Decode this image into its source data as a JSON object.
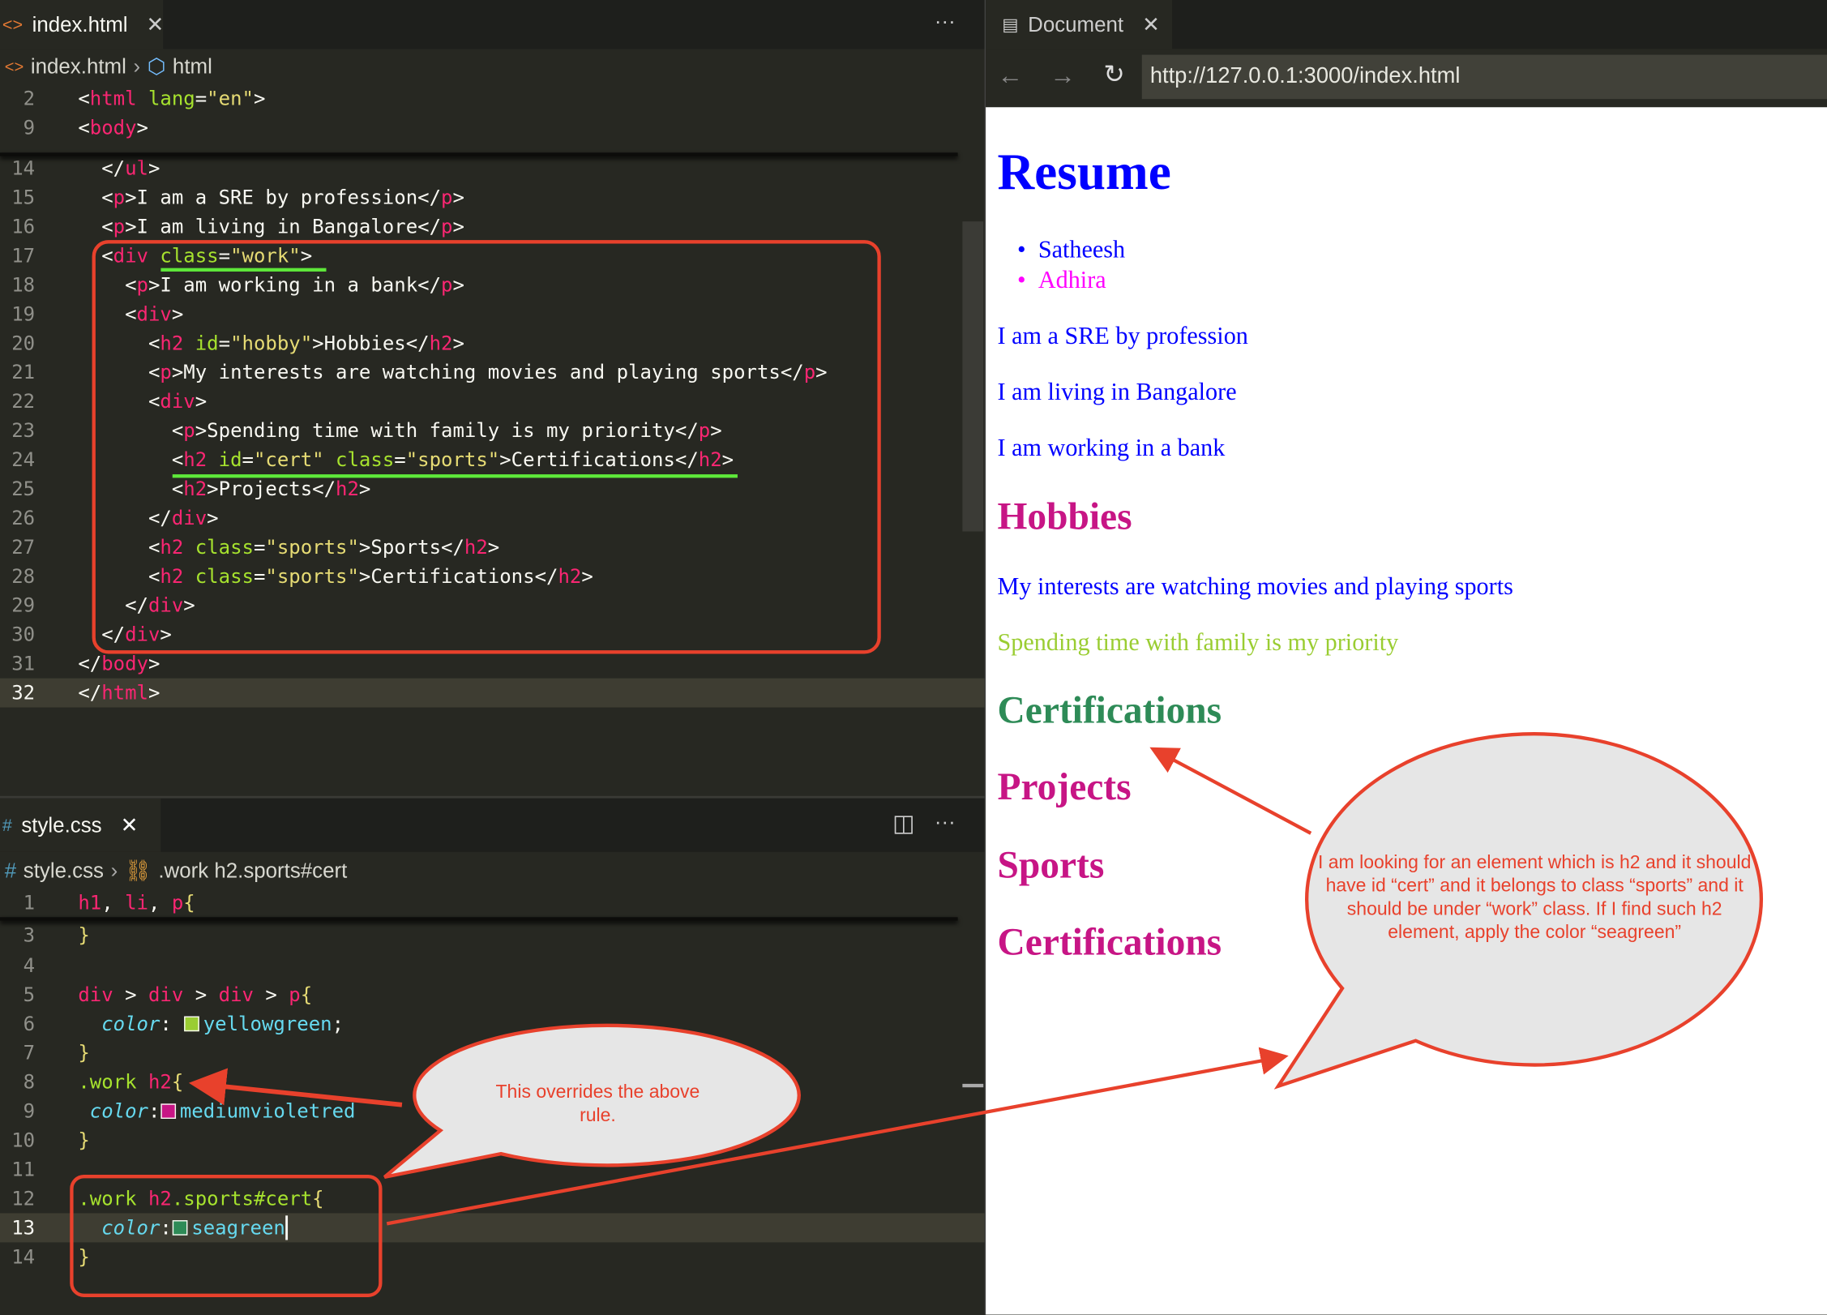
{
  "html_editor": {
    "tab_label": "index.html",
    "more_label": "···",
    "breadcrumb": [
      "index.html",
      "html"
    ],
    "current_line": 32,
    "lines": [
      {
        "num": 2,
        "tokens": [
          [
            "p",
            "<"
          ],
          [
            "g",
            "html"
          ],
          [
            "x",
            " "
          ],
          [
            "a",
            "lang"
          ],
          [
            "p",
            "="
          ],
          [
            "s",
            "\"en\""
          ],
          [
            "p",
            ">"
          ]
        ]
      },
      {
        "num": 9,
        "tokens": [
          [
            "p",
            "<"
          ],
          [
            "g",
            "body"
          ],
          [
            "p",
            ">"
          ]
        ]
      },
      {
        "num": 14,
        "tokens": [
          [
            "x",
            "  "
          ],
          [
            "p",
            "</"
          ],
          [
            "g",
            "ul"
          ],
          [
            "p",
            ">"
          ]
        ]
      },
      {
        "num": 15,
        "tokens": [
          [
            "x",
            "  "
          ],
          [
            "p",
            "<"
          ],
          [
            "g",
            "p"
          ],
          [
            "p",
            ">"
          ],
          [
            "x",
            "I am a SRE by profession"
          ],
          [
            "p",
            "</"
          ],
          [
            "g",
            "p"
          ],
          [
            "p",
            ">"
          ]
        ]
      },
      {
        "num": 16,
        "tokens": [
          [
            "x",
            "  "
          ],
          [
            "p",
            "<"
          ],
          [
            "g",
            "p"
          ],
          [
            "p",
            ">"
          ],
          [
            "x",
            "I am living in Bangalore"
          ],
          [
            "p",
            "</"
          ],
          [
            "g",
            "p"
          ],
          [
            "p",
            ">"
          ]
        ]
      },
      {
        "num": 17,
        "tokens": [
          [
            "x",
            "  "
          ],
          [
            "p",
            "<"
          ],
          [
            "g",
            "div"
          ],
          [
            "x",
            " "
          ],
          [
            "a",
            "class"
          ],
          [
            "p",
            "="
          ],
          [
            "s",
            "\"work\""
          ],
          [
            "p",
            ">"
          ]
        ]
      },
      {
        "num": 18,
        "tokens": [
          [
            "x",
            "    "
          ],
          [
            "p",
            "<"
          ],
          [
            "g",
            "p"
          ],
          [
            "p",
            ">"
          ],
          [
            "x",
            "I am working in a bank"
          ],
          [
            "p",
            "</"
          ],
          [
            "g",
            "p"
          ],
          [
            "p",
            ">"
          ]
        ]
      },
      {
        "num": 19,
        "tokens": [
          [
            "x",
            "    "
          ],
          [
            "p",
            "<"
          ],
          [
            "g",
            "div"
          ],
          [
            "p",
            ">"
          ]
        ]
      },
      {
        "num": 20,
        "tokens": [
          [
            "x",
            "      "
          ],
          [
            "p",
            "<"
          ],
          [
            "g",
            "h2"
          ],
          [
            "x",
            " "
          ],
          [
            "a",
            "id"
          ],
          [
            "p",
            "="
          ],
          [
            "s",
            "\"hobby\""
          ],
          [
            "p",
            ">"
          ],
          [
            "x",
            "Hobbies"
          ],
          [
            "p",
            "</"
          ],
          [
            "g",
            "h2"
          ],
          [
            "p",
            ">"
          ]
        ]
      },
      {
        "num": 21,
        "tokens": [
          [
            "x",
            "      "
          ],
          [
            "p",
            "<"
          ],
          [
            "g",
            "p"
          ],
          [
            "p",
            ">"
          ],
          [
            "x",
            "My interests are watching movies and playing sports"
          ],
          [
            "p",
            "</"
          ],
          [
            "g",
            "p"
          ],
          [
            "p",
            ">"
          ]
        ]
      },
      {
        "num": 22,
        "tokens": [
          [
            "x",
            "      "
          ],
          [
            "p",
            "<"
          ],
          [
            "g",
            "div"
          ],
          [
            "p",
            ">"
          ]
        ]
      },
      {
        "num": 23,
        "tokens": [
          [
            "x",
            "        "
          ],
          [
            "p",
            "<"
          ],
          [
            "g",
            "p"
          ],
          [
            "p",
            ">"
          ],
          [
            "x",
            "Spending time with family is my priority"
          ],
          [
            "p",
            "</"
          ],
          [
            "g",
            "p"
          ],
          [
            "p",
            ">"
          ]
        ]
      },
      {
        "num": 24,
        "tokens": [
          [
            "x",
            "        "
          ],
          [
            "p",
            "<"
          ],
          [
            "g",
            "h2"
          ],
          [
            "x",
            " "
          ],
          [
            "a",
            "id"
          ],
          [
            "p",
            "="
          ],
          [
            "s",
            "\"cert\""
          ],
          [
            "x",
            " "
          ],
          [
            "a",
            "class"
          ],
          [
            "p",
            "="
          ],
          [
            "s",
            "\"sports\""
          ],
          [
            "p",
            ">"
          ],
          [
            "x",
            "Certifications"
          ],
          [
            "p",
            "</"
          ],
          [
            "g",
            "h2"
          ],
          [
            "p",
            ">"
          ]
        ]
      },
      {
        "num": 25,
        "tokens": [
          [
            "x",
            "        "
          ],
          [
            "p",
            "<"
          ],
          [
            "g",
            "h2"
          ],
          [
            "p",
            ">"
          ],
          [
            "x",
            "Projects"
          ],
          [
            "p",
            "</"
          ],
          [
            "g",
            "h2"
          ],
          [
            "p",
            ">"
          ]
        ]
      },
      {
        "num": 26,
        "tokens": [
          [
            "x",
            "      "
          ],
          [
            "p",
            "</"
          ],
          [
            "g",
            "div"
          ],
          [
            "p",
            ">"
          ]
        ]
      },
      {
        "num": 27,
        "tokens": [
          [
            "x",
            "      "
          ],
          [
            "p",
            "<"
          ],
          [
            "g",
            "h2"
          ],
          [
            "x",
            " "
          ],
          [
            "a",
            "class"
          ],
          [
            "p",
            "="
          ],
          [
            "s",
            "\"sports\""
          ],
          [
            "p",
            ">"
          ],
          [
            "x",
            "Sports"
          ],
          [
            "p",
            "</"
          ],
          [
            "g",
            "h2"
          ],
          [
            "p",
            ">"
          ]
        ]
      },
      {
        "num": 28,
        "tokens": [
          [
            "x",
            "      "
          ],
          [
            "p",
            "<"
          ],
          [
            "g",
            "h2"
          ],
          [
            "x",
            " "
          ],
          [
            "a",
            "class"
          ],
          [
            "p",
            "="
          ],
          [
            "s",
            "\"sports\""
          ],
          [
            "p",
            ">"
          ],
          [
            "x",
            "Certifications"
          ],
          [
            "p",
            "</"
          ],
          [
            "g",
            "h2"
          ],
          [
            "p",
            ">"
          ]
        ]
      },
      {
        "num": 29,
        "tokens": [
          [
            "x",
            "    "
          ],
          [
            "p",
            "</"
          ],
          [
            "g",
            "div"
          ],
          [
            "p",
            ">"
          ]
        ]
      },
      {
        "num": 30,
        "tokens": [
          [
            "x",
            "  "
          ],
          [
            "p",
            "</"
          ],
          [
            "g",
            "div"
          ],
          [
            "p",
            ">"
          ]
        ]
      },
      {
        "num": 31,
        "tokens": [
          [
            "p",
            "</"
          ],
          [
            "g",
            "body"
          ],
          [
            "p",
            ">"
          ]
        ]
      },
      {
        "num": 32,
        "tokens": [
          [
            "p",
            "</"
          ],
          [
            "g",
            "html"
          ],
          [
            "p",
            ">"
          ]
        ]
      }
    ]
  },
  "css_editor": {
    "tab_label": "style.css",
    "more_label": "···",
    "breadcrumb": [
      "style.css",
      ".work h2.sports#cert"
    ],
    "current_line": 13,
    "lines": [
      {
        "num": 1,
        "tokens": [
          [
            "g",
            "h1"
          ],
          [
            "p",
            ", "
          ],
          [
            "g",
            "li"
          ],
          [
            "p",
            ", "
          ],
          [
            "g",
            "p"
          ],
          [
            "y",
            "{"
          ]
        ]
      },
      {
        "num": 3,
        "tokens": [
          [
            "y",
            "}"
          ]
        ]
      },
      {
        "num": 4,
        "tokens": []
      },
      {
        "num": 5,
        "tokens": [
          [
            "g",
            "div"
          ],
          [
            "p",
            " > "
          ],
          [
            "g",
            "div"
          ],
          [
            "p",
            " > "
          ],
          [
            "g",
            "div"
          ],
          [
            "p",
            " > "
          ],
          [
            "g",
            "p"
          ],
          [
            "y",
            "{"
          ]
        ]
      },
      {
        "num": 6,
        "tokens": [
          [
            "x",
            "  "
          ],
          [
            "k",
            "color"
          ],
          [
            "p",
            ": "
          ],
          [
            "sw",
            "#9acd32"
          ],
          [
            "v",
            "yellowgreen"
          ],
          [
            "p",
            ";"
          ]
        ]
      },
      {
        "num": 7,
        "tokens": [
          [
            "y",
            "}"
          ]
        ]
      },
      {
        "num": 8,
        "tokens": [
          [
            "c",
            ".work"
          ],
          [
            "x",
            " "
          ],
          [
            "g",
            "h2"
          ],
          [
            "y",
            "{"
          ]
        ]
      },
      {
        "num": 9,
        "tokens": [
          [
            "x",
            " "
          ],
          [
            "k",
            "color"
          ],
          [
            "p",
            ":"
          ],
          [
            "sw",
            "#c71585"
          ],
          [
            "v",
            "mediumvioletred"
          ]
        ]
      },
      {
        "num": 10,
        "tokens": [
          [
            "y",
            "}"
          ]
        ]
      },
      {
        "num": 11,
        "tokens": []
      },
      {
        "num": 12,
        "tokens": [
          [
            "c",
            ".work"
          ],
          [
            "x",
            " "
          ],
          [
            "g",
            "h2"
          ],
          [
            "c",
            ".sports#cert"
          ],
          [
            "y",
            "{"
          ]
        ]
      },
      {
        "num": 13,
        "tokens": [
          [
            "x",
            "  "
          ],
          [
            "k",
            "color"
          ],
          [
            "p",
            ":"
          ],
          [
            "sw",
            "#2e8b57"
          ],
          [
            "v",
            "seagreen"
          ],
          [
            "cur",
            ""
          ]
        ]
      },
      {
        "num": 14,
        "tokens": [
          [
            "y",
            "}"
          ]
        ]
      }
    ]
  },
  "browser": {
    "tab_label": "Document",
    "url": "http://127.0.0.1:3000/index.html",
    "content": [
      {
        "kind": "h1",
        "text": "Resume",
        "color": "#0000ff"
      },
      {
        "kind": "li",
        "text": "Satheesh",
        "color": "#0000ff"
      },
      {
        "kind": "li",
        "text": "Adhira",
        "color": "#ff00ff"
      },
      {
        "kind": "p",
        "text": "I am a SRE by profession",
        "color": "#0000ff"
      },
      {
        "kind": "p",
        "text": "I am living in Bangalore",
        "color": "#0000ff"
      },
      {
        "kind": "p",
        "text": "I am working in a bank",
        "color": "#0000ff"
      },
      {
        "kind": "h2",
        "text": "Hobbies",
        "color": "#c71585"
      },
      {
        "kind": "p",
        "text": "My interests are watching movies and playing sports",
        "color": "#0000ff"
      },
      {
        "kind": "p",
        "text": "Spending time with family is my priority",
        "color": "#9acd32"
      },
      {
        "kind": "h2",
        "text": "Certifications",
        "color": "#2e8b57"
      },
      {
        "kind": "h2",
        "text": "Projects",
        "color": "#c71585"
      },
      {
        "kind": "h2",
        "text": "Sports",
        "color": "#c71585"
      },
      {
        "kind": "h2",
        "text": "Certifications",
        "color": "#c71585"
      }
    ]
  },
  "annotations": {
    "override_note": "This overrides the above rule.",
    "selector_note": "I am looking for an element which is h2 and it should have id “cert” and it belongs to class “sports” and it should be under “work” class. If I find such h2 element, apply the color “seagreen”",
    "annotation_color": "#e8412c",
    "highlight_color": "#5ee83a"
  }
}
